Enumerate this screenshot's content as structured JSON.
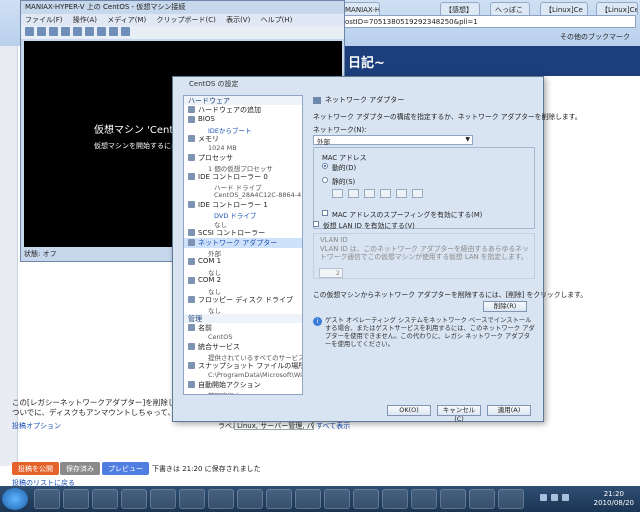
{
  "browser": {
    "tabs": [
      {
        "label": "MANIAX-HYPER-V 上の CentOS - 仮想マシン接続"
      },
      {
        "label": "【Linux]Ce"
      },
      {
        "label": "【感想】"
      },
      {
        "label": "へっぽこ"
      },
      {
        "label": "【Linux]Ce"
      }
    ],
    "address": "ostID=7051380519292348250&pli=1",
    "bookmarks": "その他のブックマーク"
  },
  "blog": {
    "banner": "日記~",
    "editor_line1": "この[レガシーネットワークアダプター]を削除して、普通の[ネットワークアダプター]にします",
    "editor_line2": "ついでに、ディスクもアンマウントしちゃって、ブートをIDEからブートに変えましょう",
    "options_label": "投稿オプション",
    "labels_label": "ラベル:",
    "labels_value": "Linux, サーバー管理, パソコ",
    "show_all": "すべて表示",
    "publish_btn": "投稿を公開",
    "saved_btn": "保存済み",
    "preview_btn": "プレビュー",
    "autosave": "下書きは 21:20 に保存されました",
    "back_link": "投稿のリストに戻る"
  },
  "vm": {
    "title": "MANIAX-HYPER-V 上の CentOS - 仮想マシン接続",
    "menu": [
      "ファイル(F)",
      "操作(A)",
      "メディア(M)",
      "クリップボード(C)",
      "表示(V)",
      "ヘルプ(H)"
    ],
    "screen_title": "仮想マシン 'CentOS'",
    "screen_msg": "仮想マシンを開始するには、[操",
    "status": "状態: オフ"
  },
  "dialog": {
    "title": "CentOS の設定",
    "tree": [
      {
        "type": "sec",
        "label": "ハードウェア"
      },
      {
        "type": "item",
        "label": "ハードウェアの追加"
      },
      {
        "type": "item",
        "label": "BIOS"
      },
      {
        "type": "sub",
        "label": "IDEからブート",
        "link": true
      },
      {
        "type": "item",
        "label": "メモリ"
      },
      {
        "type": "sub",
        "label": "1024 MB"
      },
      {
        "type": "item",
        "label": "プロセッサ"
      },
      {
        "type": "sub",
        "label": "1 個の仮想プロセッサ"
      },
      {
        "type": "item",
        "label": "IDE コントローラー 0"
      },
      {
        "type": "sub2",
        "label": "ハード ドライブ"
      },
      {
        "type": "sub2",
        "label": "CentOS_28A4C12C-8864-4..."
      },
      {
        "type": "item",
        "label": "IDE コントローラー 1"
      },
      {
        "type": "sub2",
        "label": "DVD ドライブ",
        "link": true
      },
      {
        "type": "sub2",
        "label": "なし"
      },
      {
        "type": "item",
        "label": "SCSI コントローラー"
      },
      {
        "type": "item",
        "label": "ネットワーク アダプター",
        "selected": true
      },
      {
        "type": "sub",
        "label": "外部"
      },
      {
        "type": "item",
        "label": "COM 1"
      },
      {
        "type": "sub",
        "label": "なし"
      },
      {
        "type": "item",
        "label": "COM 2"
      },
      {
        "type": "sub",
        "label": "なし"
      },
      {
        "type": "item",
        "label": "フロッピー ディスク ドライブ"
      },
      {
        "type": "sub",
        "label": "なし"
      },
      {
        "type": "sec",
        "label": "管理"
      },
      {
        "type": "item",
        "label": "名前"
      },
      {
        "type": "sub",
        "label": "CentOS"
      },
      {
        "type": "item",
        "label": "統合サービス"
      },
      {
        "type": "sub",
        "label": "提供されているすべてのサービス"
      },
      {
        "type": "item",
        "label": "スナップショット ファイルの場所"
      },
      {
        "type": "sub",
        "label": "C:\\ProgramData\\Microsoft\\Wi..."
      },
      {
        "type": "item",
        "label": "自動開始アクション"
      },
      {
        "type": "sub",
        "label": "前回実行中"
      },
      {
        "type": "item",
        "label": "自動停止アクション"
      }
    ],
    "nic_header": "ネットワーク アダプター",
    "nic_desc": "ネットワーク アダプターの構成を指定するか、ネットワーク アダプターを削除します。",
    "network_label": "ネットワーク(N):",
    "network_value": "外部",
    "mac_label": "MAC アドレス",
    "mac_dynamic": "動的(D)",
    "mac_static": "静的(S)",
    "mac_fields": [
      "",
      "",
      "",
      "",
      "",
      ""
    ],
    "mac_spoof": "MAC アドレスのスプーフィングを有効にする(M)",
    "vlan_check": "仮想 LAN ID を有効にする(V)",
    "vlan_title": "VLAN ID",
    "vlan_desc": "VLAN ID は、このネットワーク アダプターを経由するあらゆるネットワーク通信でこの仮想マシンが使用する仮想 LAN を指定します。",
    "vlan_value": "2",
    "remove_desc": "この仮想マシンからネットワーク アダプターを削除するには、[削除] をクリックします。",
    "remove_btn": "削除(R)",
    "info_text": "ゲスト オペレーティング システムをネットワーク ベースでインストールする場合、またはゲストサービスを利用するには、このネットワーク アダプターを使用できません。この代わりに、レガシ ネットワーク アダプターを使用してください。",
    "ok": "OK(O)",
    "cancel": "キャンセル(C)",
    "apply": "適用(A)"
  },
  "taskbar": {
    "time": "21:20",
    "date": "2010/08/20",
    "apps": [
      "",
      "",
      "",
      "",
      "",
      "",
      "",
      "",
      "",
      "",
      "",
      "",
      "",
      "",
      "",
      "",
      ""
    ]
  }
}
